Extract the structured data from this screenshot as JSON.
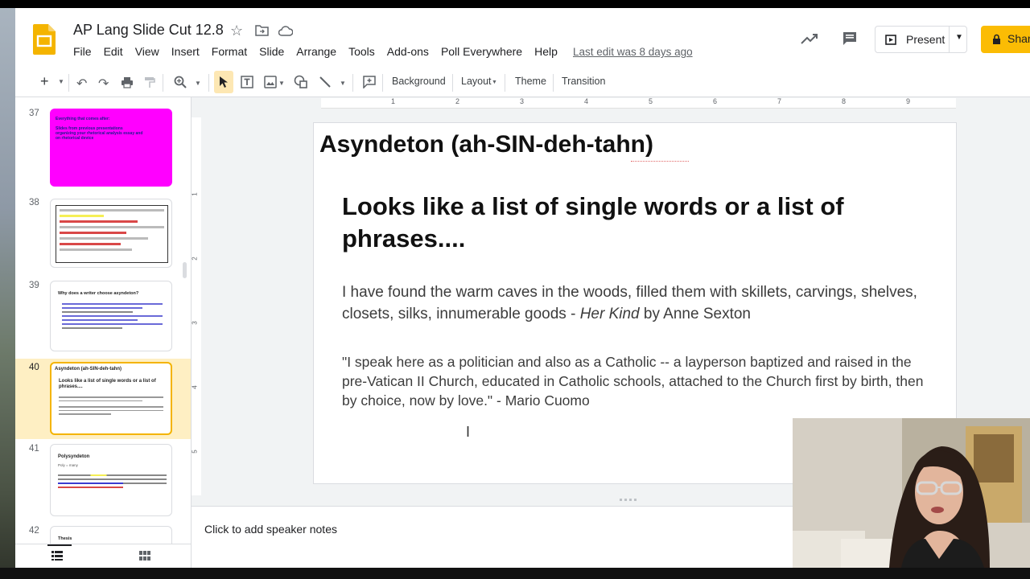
{
  "doc": {
    "title": "AP Lang Slide Cut 12.8",
    "last_edit": "Last edit was 8 days ago",
    "present_label": "Present",
    "share_label": "Shar"
  },
  "menu": [
    "File",
    "Edit",
    "View",
    "Insert",
    "Format",
    "Slide",
    "Arrange",
    "Tools",
    "Add-ons",
    "Poll Everywhere",
    "Help"
  ],
  "toolbar": {
    "background": "Background",
    "layout": "Layout",
    "theme": "Theme",
    "transition": "Transition"
  },
  "ruler": {
    "h_ticks": [
      "1",
      "2",
      "3",
      "4",
      "5",
      "6",
      "7",
      "8",
      "9"
    ],
    "v_ticks": [
      "1",
      "2",
      "3",
      "4",
      "5"
    ]
  },
  "filmstrip": {
    "slides": [
      {
        "num": "37",
        "lines": [
          "Everything that comes after:",
          "",
          "Slides from previous presentations",
          "organizing your rhetorical analysis essay and",
          "on rhetorical device"
        ]
      },
      {
        "num": "38",
        "lines": []
      },
      {
        "num": "39",
        "lines": [
          "Why does a writer choose asyndeton?"
        ]
      },
      {
        "num": "40",
        "lines": [
          "Asyndeton (ah-SIN-deh-tahn)",
          "Looks like a list of single words or a list of phrases...."
        ]
      },
      {
        "num": "41",
        "lines": [
          "Polysyndeton",
          "Poly = many"
        ]
      },
      {
        "num": "42",
        "lines": [
          "Thesis"
        ]
      }
    ]
  },
  "slide": {
    "title": "Asyndeton (ah-SIN-deh-tahn)",
    "heading": "Looks like a list of single words or a list of phrases....",
    "quote1_main": "I have found the warm caves in the woods, filled them with skillets, carvings, shelves, closets, silks, innumerable goods - ",
    "quote1_work": "Her Kind",
    "quote1_author": " by Anne Sexton",
    "quote2": "\"I speak here as a politician and also as a Catholic -- a layperson baptized and raised in the pre-Vatican II Church, educated in Catholic schools, attached to the Church first by birth, then by choice, now by love.\" - Mario Cuomo"
  },
  "notes_placeholder": "Click to add speaker notes",
  "colors": {
    "accent": "#fbbc04",
    "selection": "#f4b400",
    "magenta": "#ff00ff"
  }
}
